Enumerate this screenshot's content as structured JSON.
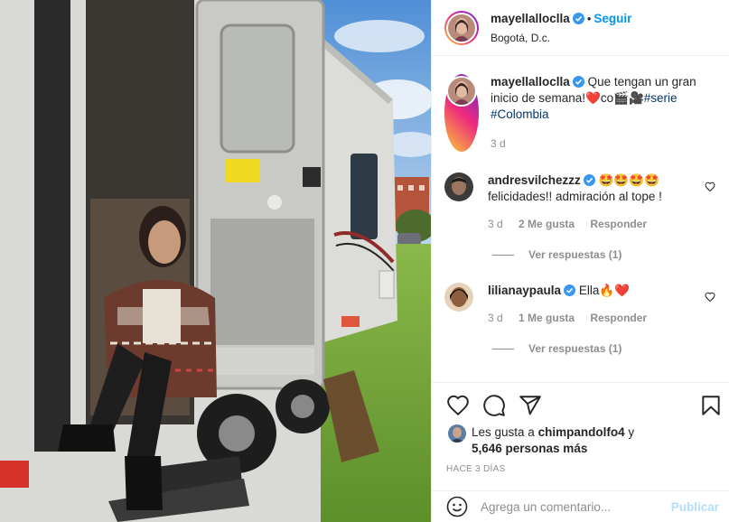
{
  "post": {
    "username": "mayellalloclla",
    "follow_label": "Seguir",
    "location": "Bogotá, D.c."
  },
  "caption": {
    "username": "mayellalloclla",
    "text_part1": "Que tengan un gran inicio de semana!",
    "emoji_heart": "❤️",
    "text_co": "co",
    "emoji_clapper": "🎬",
    "emoji_camera": "🎥",
    "hashtag1": "#serie",
    "hashtag2": "#Colombia",
    "age": "3 d"
  },
  "comments": [
    {
      "username": "andresvilchezzz",
      "emojis": "🤩🤩🤩🤩",
      "text": "felicidades!! admiración al tope !",
      "age": "3 d",
      "likes": "2 Me gusta",
      "reply_label": "Responder",
      "view_replies": "Ver respuestas (1)"
    },
    {
      "username": "lilianaypaula",
      "text": "Ella🔥❤️",
      "age": "3 d",
      "likes": "1 Me gusta",
      "reply_label": "Responder",
      "view_replies": "Ver respuestas (1)"
    }
  ],
  "likes": {
    "prefix": "Les gusta a",
    "user": "chimpandolfo4",
    "joiner": "y",
    "others": "5,646 personas más"
  },
  "timestamp": "HACE 3 DÍAS",
  "add_comment": {
    "placeholder": "Agrega un comentario...",
    "publish_label": "Publicar"
  },
  "colors": {
    "link_blue": "#0095f6",
    "verified_blue": "#3897f0",
    "publish_disabled": "#b2dffc",
    "hashtag": "#00376b",
    "heart_red": "#ed4956"
  },
  "icons": [
    "verified-badge-icon",
    "heart-icon",
    "comment-icon",
    "share-icon",
    "bookmark-icon",
    "emoji-icon"
  ]
}
